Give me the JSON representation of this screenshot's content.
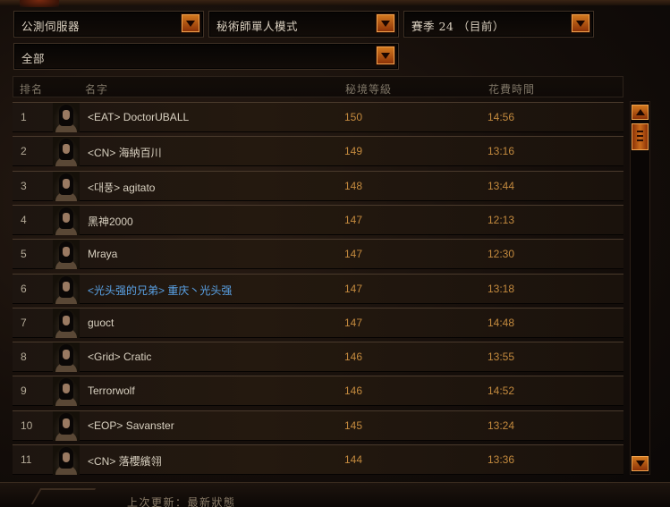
{
  "filters": {
    "server": "公測伺服器",
    "mode": "秘術師單人模式",
    "season": "賽季 24 （目前）",
    "clan": "全部"
  },
  "columns": {
    "rank": "排名",
    "name": "名字",
    "level": "秘境等級",
    "time": "花費時間"
  },
  "rows": [
    {
      "rank": "1",
      "name": "<EAT> DoctorUBALL",
      "level": "150",
      "time": "14:56",
      "friend": false
    },
    {
      "rank": "2",
      "name": "<CN> 海納百川",
      "level": "149",
      "time": "13:16",
      "friend": false
    },
    {
      "rank": "3",
      "name": "<대풍> agitato",
      "level": "148",
      "time": "13:44",
      "friend": false
    },
    {
      "rank": "4",
      "name": "黑神2000",
      "level": "147",
      "time": "12:13",
      "friend": false
    },
    {
      "rank": "5",
      "name": "Mraya",
      "level": "147",
      "time": "12:30",
      "friend": false
    },
    {
      "rank": "6",
      "name": "<光头强的兄弟> 重庆丶光头强",
      "level": "147",
      "time": "13:18",
      "friend": true
    },
    {
      "rank": "7",
      "name": "guoct",
      "level": "147",
      "time": "14:48",
      "friend": false
    },
    {
      "rank": "8",
      "name": "<Grid> Cratic",
      "level": "146",
      "time": "13:55",
      "friend": false
    },
    {
      "rank": "9",
      "name": "Terrorwolf",
      "level": "146",
      "time": "14:52",
      "friend": false
    },
    {
      "rank": "10",
      "name": "<EOP> Savanster",
      "level": "145",
      "time": "13:24",
      "friend": false
    },
    {
      "rank": "11",
      "name": "<CN> 落櫻繽翎",
      "level": "144",
      "time": "13:36",
      "friend": false
    }
  ],
  "footer": {
    "last_updated": "上次更新：最新狀態"
  },
  "colors": {
    "accent_orange": "#c96a1a",
    "value_text": "#c48a3e",
    "friend_name": "#5aa2e6"
  }
}
